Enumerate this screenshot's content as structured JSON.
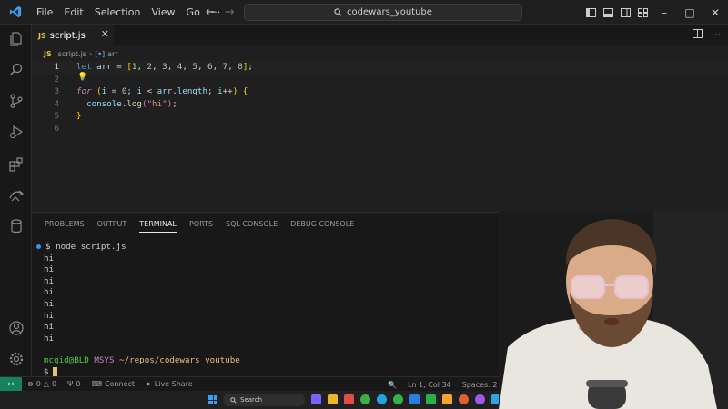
{
  "menu": [
    "File",
    "Edit",
    "Selection",
    "View",
    "Go",
    "···"
  ],
  "search": {
    "text": "codewars_youtube"
  },
  "tab": {
    "badge": "JS",
    "name": "script.js"
  },
  "breadcrumb": {
    "file": "script.js",
    "symbol": "arr"
  },
  "editor": {
    "line_numbers": [
      "1",
      "2",
      "3",
      "4",
      "5",
      "6"
    ],
    "line1": {
      "kw": "let",
      "var": "arr",
      "eq": " = ",
      "nums": [
        "1",
        "2",
        "3",
        "4",
        "5",
        "6",
        "7",
        "8"
      ]
    },
    "line3": {
      "for": "for",
      "i": "i",
      "zero": "0",
      "arr": "arr",
      "length": "length"
    },
    "line4": {
      "console": "console",
      "log": "log",
      "str": "\"hi\""
    }
  },
  "panel": {
    "tabs": [
      "PROBLEMS",
      "OUTPUT",
      "TERMINAL",
      "PORTS",
      "SQL CONSOLE",
      "DEBUG CONSOLE"
    ],
    "active_tab": "TERMINAL"
  },
  "terminal": {
    "command": "$ node script.js",
    "output": [
      "hi",
      "hi",
      "hi",
      "hi",
      "hi",
      "hi",
      "hi",
      "hi"
    ],
    "prompt_user": "mcgid@BLD",
    "prompt_sys": "MSYS",
    "prompt_path": "~/repos/codewars_youtube",
    "prompt_symbol": "$"
  },
  "status": {
    "errors": "0",
    "warnings": "0",
    "ports": "0",
    "connect": "Connect",
    "live_share": "Live Share",
    "position": "Ln 1, Col 34",
    "spaces": "Spaces: 2"
  },
  "taskbar": {
    "search": "Search"
  },
  "colors": {
    "accent": "#0078d4",
    "remote": "#16825d",
    "js": "#e8c346"
  }
}
